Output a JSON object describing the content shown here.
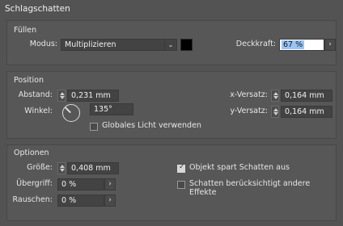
{
  "window": {
    "title": "Schlagschatten"
  },
  "fill": {
    "heading": "Füllen",
    "mode_label": "Modus:",
    "mode_value": "Multiplizieren",
    "opacity_label": "Deckkraft:",
    "opacity_value": "67 %",
    "swatch_color": "#000000"
  },
  "position": {
    "heading": "Position",
    "distance_label": "Abstand:",
    "distance_value": "0,231 mm",
    "angle_label": "Winkel:",
    "angle_value": "135°",
    "global_light_label": "Globales Licht verwenden",
    "global_light_checked": false,
    "x_offset_label": "x-Versatz:",
    "x_offset_value": "0,164 mm",
    "y_offset_label": "y-Versatz:",
    "y_offset_value": "0,164 mm"
  },
  "options": {
    "heading": "Optionen",
    "size_label": "Größe:",
    "size_value": "0,408 mm",
    "spread_label": "Übergriff:",
    "spread_value": "0 %",
    "noise_label": "Rauschen:",
    "noise_value": "0 %",
    "knockout_label": "Objekt spart Schatten aus",
    "knockout_checked": true,
    "honor_effects_label": "Schatten berücksichtigt andere Effekte",
    "honor_effects_checked": false
  },
  "icons": {
    "arrow": "›",
    "chevron": "⌄"
  }
}
